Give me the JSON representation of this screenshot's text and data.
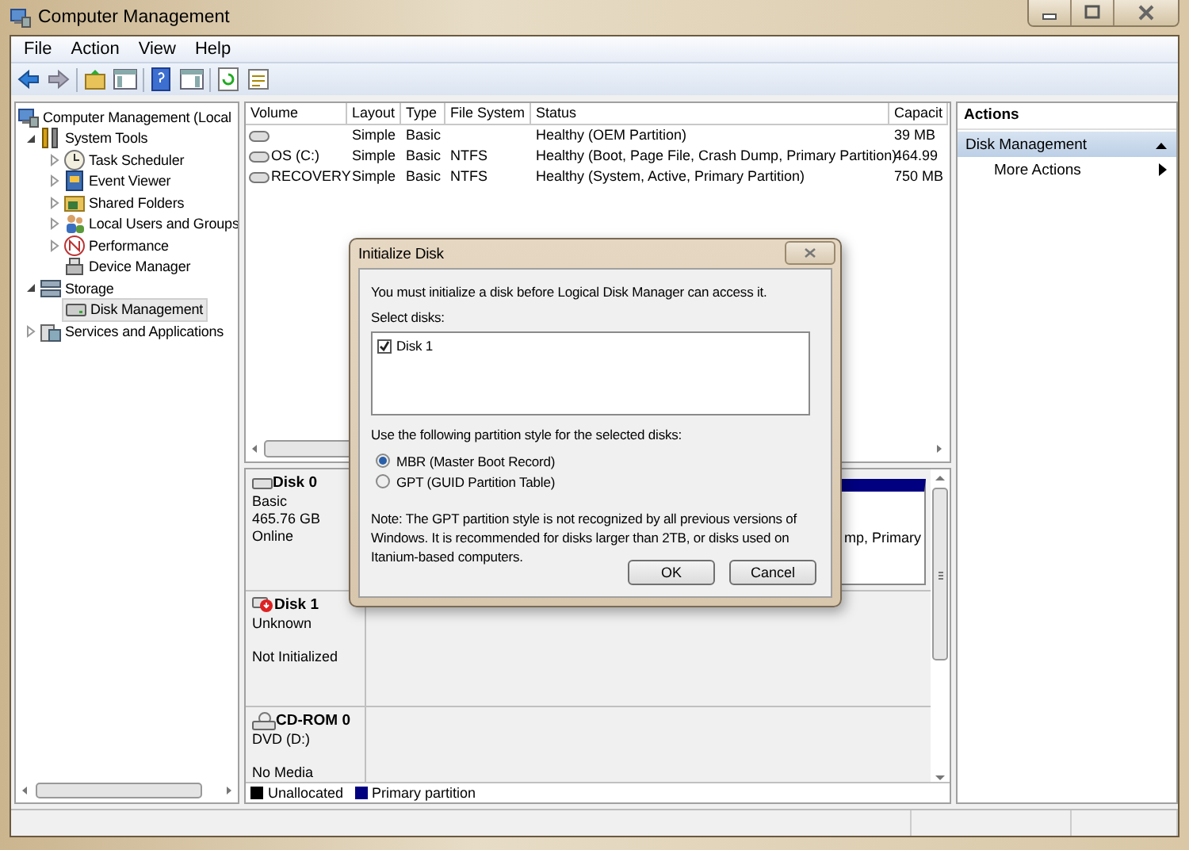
{
  "window": {
    "title": "Computer Management"
  },
  "menu": [
    {
      "label": "File"
    },
    {
      "label": "Action"
    },
    {
      "label": "View"
    },
    {
      "label": "Help"
    }
  ],
  "tree": {
    "items": [
      {
        "label": "Computer Management (Local",
        "selected": false,
        "children": [
          {
            "label": "System Tools",
            "expanded": true,
            "selected": false,
            "children": [
              {
                "label": "Task Scheduler",
                "expanded": false,
                "selected": false
              },
              {
                "label": "Event Viewer",
                "expanded": false,
                "selected": false
              },
              {
                "label": "Shared Folders",
                "expanded": false,
                "selected": false
              },
              {
                "label": "Local Users and Groups",
                "expanded": false,
                "selected": false
              },
              {
                "label": "Performance",
                "expanded": false,
                "selected": false
              },
              {
                "label": "Device Manager",
                "selected": false
              }
            ]
          },
          {
            "label": "Storage",
            "expanded": true,
            "selected": false,
            "children": [
              {
                "label": "Disk Management",
                "selected": true
              }
            ]
          },
          {
            "label": "Services and Applications",
            "expanded": false,
            "selected": false
          }
        ]
      }
    ]
  },
  "volumes": {
    "columns": [
      "Volume",
      "Layout",
      "Type",
      "File System",
      "Status",
      "Capacit"
    ],
    "rows": [
      {
        "layout": "Simple",
        "type": "Basic",
        "status": "Healthy (OEM Partition)",
        "capacity": "39 MB"
      },
      {
        "volume": "OS (C:)",
        "layout": "Simple",
        "type": "Basic",
        "file_system": "NTFS",
        "status": "Healthy (Boot, Page File, Crash Dump, Primary Partition)",
        "capacity": "464.99"
      },
      {
        "volume": "RECOVERY",
        "layout": "Simple",
        "type": "Basic",
        "file_system": "NTFS",
        "status": "Healthy (System, Active, Primary Partition)",
        "capacity": "750 MB"
      }
    ]
  },
  "disks": [
    {
      "kind": "basic",
      "name": "Disk 0",
      "type": "Basic",
      "size": "465.76 GB",
      "status": "Online",
      "partition_text": "mp, Primary"
    },
    {
      "kind": "uninitialized",
      "name": "Disk 1",
      "type": "Unknown",
      "status": "Not Initialized"
    },
    {
      "kind": "cdrom",
      "name": "CD-ROM 0",
      "type": "DVD (D:)",
      "status": "No Media"
    }
  ],
  "legend": [
    {
      "label": "Unallocated",
      "color": "#000000"
    },
    {
      "label": "Primary partition",
      "color": "#000080"
    }
  ],
  "actions": {
    "title": "Actions",
    "section": "Disk Management",
    "items": [
      {
        "label": "More Actions"
      }
    ]
  },
  "dialog": {
    "title": "Initialize Disk",
    "message": "You must initialize a disk before Logical Disk Manager can access it.",
    "select_label": "Select disks:",
    "disks": [
      {
        "label": "Disk 1",
        "checked": true
      }
    ],
    "style_label": "Use the following partition style for the selected disks:",
    "styles": [
      {
        "label": "MBR (Master Boot Record)",
        "selected": true
      },
      {
        "label": "GPT (GUID Partition Table)",
        "selected": false
      }
    ],
    "note": "Note: The GPT partition style is not recognized by all previous versions of Windows. It is recommended for disks larger than 2TB, or disks used on Itanium-based computers.",
    "buttons": [
      "OK",
      "Cancel"
    ]
  }
}
